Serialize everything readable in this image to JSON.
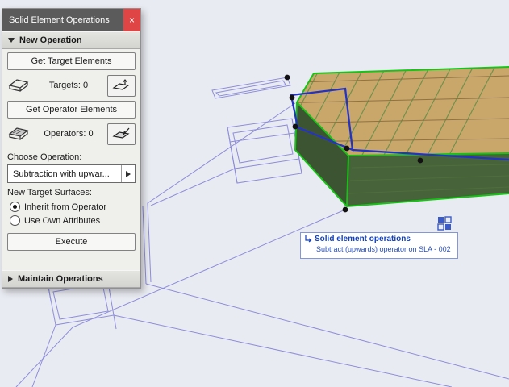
{
  "palette": {
    "title": "Solid Element Operations",
    "close_label": "×",
    "new_operation_header": "New Operation",
    "get_target_button": "Get Target Elements",
    "targets_label": "Targets: 0",
    "get_operator_button": "Get Operator Elements",
    "operators_label": "Operators: 0",
    "choose_operation_label": "Choose Operation:",
    "operation_dropdown_value": "Subtraction with upwar...",
    "new_target_surfaces_label": "New Target Surfaces:",
    "radio_inherit_label": "Inherit from Operator",
    "radio_own_label": "Use Own Attributes",
    "execute_button": "Execute",
    "maintain_operations_header": "Maintain Operations"
  },
  "viewport": {
    "info_title": "Solid element operations",
    "info_detail": "Subtract (upwards) operator on SLA - 002"
  },
  "colors": {
    "selection_green": "#17c317",
    "wireframe_purple": "#8d8dda",
    "operator_blue": "#2433c4",
    "titlebar_gray": "#5b5b5b",
    "close_red": "#e04545",
    "slab_top_tan": "#c9a76b",
    "slab_side_green": "#3d5432",
    "background": "#e9ebf2"
  }
}
